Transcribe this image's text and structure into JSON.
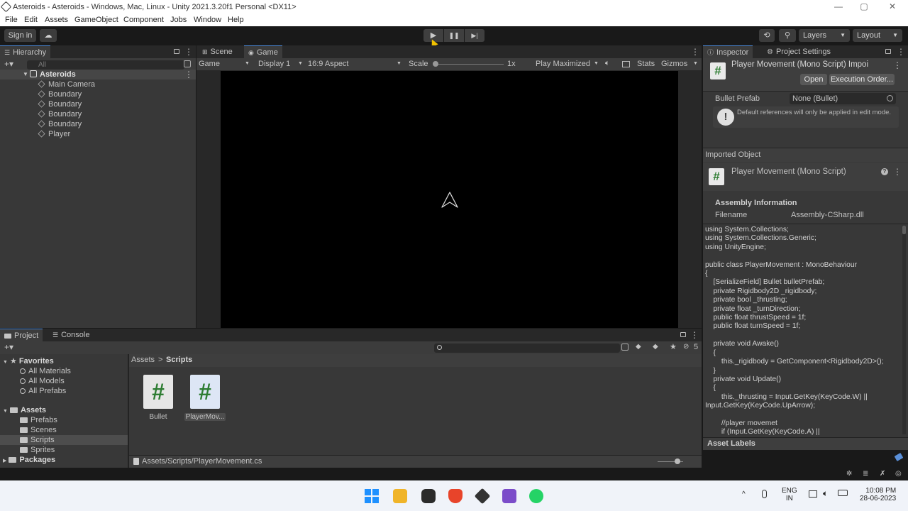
{
  "window": {
    "title": "Asteroids - Asteroids - Windows, Mac, Linux - Unity 2021.3.20f1 Personal <DX11>",
    "minimize": "—",
    "maximize": "▢",
    "close": "✕"
  },
  "menu": [
    "File",
    "Edit",
    "Assets",
    "GameObject",
    "Component",
    "Jobs",
    "Window",
    "Help"
  ],
  "toolbar": {
    "sign_in": "Sign in",
    "play": "▶",
    "pause": "❚❚",
    "step": "▶|",
    "layers": "Layers",
    "layout": "Layout"
  },
  "hierarchy": {
    "tab": "Hierarchy",
    "search_placeholder": "All",
    "scene": "Asteroids",
    "items": [
      "Main Camera",
      "Boundary",
      "Boundary",
      "Boundary",
      "Boundary",
      "Player"
    ]
  },
  "game_view": {
    "tabs": [
      "Scene",
      "Game"
    ],
    "game_dropdown": "Game",
    "display": "Display 1",
    "aspect": "16:9 Aspect",
    "scale_label": "Scale",
    "scale_value": "1x",
    "play_mode": "Play Maximized",
    "stats": "Stats",
    "gizmos": "Gizmos"
  },
  "inspector": {
    "tabs": [
      "Inspector",
      "Project Settings"
    ],
    "header_title": "Player Movement (Mono Script) Impoi",
    "open_button": "Open",
    "exec_order_button": "Execution Order...",
    "field_label": "Bullet Prefab",
    "field_value": "None (Bullet)",
    "info_message": "Default references will only be applied in edit mode.",
    "imported_object": "Imported Object",
    "script_title": "Player Movement (Mono Script)",
    "assembly_header": "Assembly Information",
    "filename_label": "Filename",
    "filename_value": "Assembly-CSharp.dll",
    "code": "using System.Collections;\nusing System.Collections.Generic;\nusing UnityEngine;\n\npublic class PlayerMovement : MonoBehaviour\n{\n    [SerializeField] Bullet bulletPrefab;\n    private Rigidbody2D _rigidbody;\n    private bool _thrusting;\n    private float _turnDirection;\n    public float thrustSpeed = 1f;\n    public float turnSpeed = 1f;\n\n    private void Awake()\n    {\n        this._rigidbody = GetComponent<Rigidbody2D>();\n    }\n    private void Update()\n    {\n        this._thrusting = Input.GetKey(KeyCode.W) ||\nInput.GetKey(KeyCode.UpArrow);\n\n        //player movemet\n        if (Input.GetKey(KeyCode.A) ||",
    "asset_labels": "Asset Labels"
  },
  "project": {
    "tabs": [
      "Project",
      "Console"
    ],
    "favorites": "Favorites",
    "favorite_items": [
      "All Materials",
      "All Models",
      "All Prefabs"
    ],
    "assets": "Assets",
    "asset_folders": [
      "Prefabs",
      "Scenes",
      "Scripts",
      "Sprites"
    ],
    "packages": "Packages",
    "breadcrumb_root": "Assets",
    "breadcrumb_sep": ">",
    "breadcrumb_current": "Scripts",
    "files": [
      "Bullet",
      "PlayerMov..."
    ],
    "hidden_count": "5",
    "status_path": "Assets/Scripts/PlayerMovement.cs"
  },
  "taskbar": {
    "lang_top": "ENG",
    "lang_bottom": "IN",
    "time": "10:08 PM",
    "date": "28-06-2023"
  }
}
